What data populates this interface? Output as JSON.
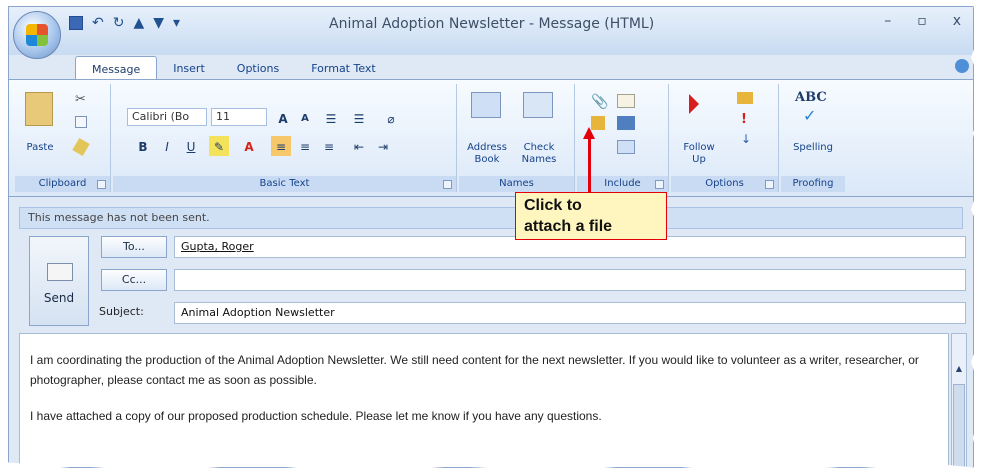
{
  "window": {
    "title": "Animal Adoption Newsletter - Message (HTML)",
    "controls": {
      "minimize": "–",
      "maximize": "▫",
      "close": "x"
    }
  },
  "qat": {
    "undo": "↶",
    "redo": "↻",
    "up": "▲",
    "down": "▼",
    "more": "▾"
  },
  "tabs": [
    "Message",
    "Insert",
    "Options",
    "Format Text"
  ],
  "ribbon": {
    "clipboard": {
      "label": "Clipboard",
      "paste": "Paste"
    },
    "basic_text": {
      "label": "Basic Text",
      "font_name": "Calibri (Bo",
      "font_size": "11",
      "bold": "B",
      "italic": "I",
      "underline": "U",
      "grow": "A",
      "shrink": "A",
      "color": "A"
    },
    "names": {
      "label": "Names",
      "address_book": "Address\nBook",
      "check_names": "Check\nNames"
    },
    "include": {
      "label": "Include"
    },
    "options": {
      "label": "Options",
      "follow_up": "Follow\nUp"
    },
    "proofing": {
      "label": "Proofing",
      "abc": "ABC",
      "spelling": "Spelling"
    }
  },
  "info_bar": "This message has not been sent.",
  "send_label": "Send",
  "fields": {
    "to_button": "To...",
    "cc_button": "Cc...",
    "subject_label": "Subject:",
    "to_value": "Gupta, Roger",
    "cc_value": "",
    "subject_value": "Animal Adoption Newsletter"
  },
  "body": {
    "para1": "I am coordinating the production of the Animal Adoption Newsletter. We still need content for the next newsletter. If you would like to volunteer as a writer, researcher, or photographer, please contact me as soon as possible.",
    "para2": "I have attached a copy of our proposed production schedule. Please let me know if you have any questions."
  },
  "callout": {
    "line1": "Click to",
    "line2": "attach a file"
  },
  "colors": {
    "accent": "#15428b",
    "callout_border": "#e3000b",
    "callout_bg": "#fff6bf"
  }
}
